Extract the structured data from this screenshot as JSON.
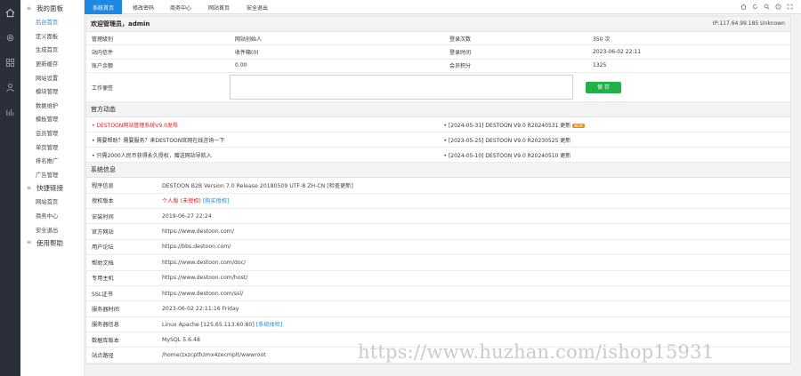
{
  "sidebar": {
    "groups": [
      {
        "title": "我的面板",
        "items": [
          "后台首页",
          "定义面板",
          "生成首页",
          "更新缓存",
          "网站设置",
          "模块管理",
          "数据维护",
          "模板管理",
          "会员管理",
          "单页管理",
          "排名推广",
          "广告管理"
        ]
      },
      {
        "title": "快捷链接",
        "items": [
          "网站首页",
          "商务中心",
          "安全退出"
        ]
      },
      {
        "title": "使用帮助",
        "items": []
      }
    ]
  },
  "topbar": {
    "tabs": [
      "系统首页",
      "修改密码",
      "商务中心",
      "网站首页",
      "安全退出"
    ]
  },
  "welcome": {
    "text": "欢迎管理员，admin",
    "ip": "IP:117.64.99.185 Unknown"
  },
  "account": {
    "rows": [
      {
        "k1": "管理级别",
        "v1": "网站创始人",
        "k2": "登录次数",
        "v2": "350 次"
      },
      {
        "k1": "站内信件",
        "v1": "收件箱(0)",
        "k2": "登录时间",
        "v2": "2023-06-02 22:11"
      },
      {
        "k1": "账户余额",
        "v1": "0.00",
        "k2": "会员积分",
        "v2": "1325"
      }
    ],
    "notes_label": "工作便签",
    "save_label": "保 存"
  },
  "notices": {
    "title": "官方动态",
    "left": [
      "• DESTOON网站管理系统V9.0发布",
      "• 需要帮助？需要服务？来DESTOON官网在线咨询一下",
      "• 只需2000人民币获得永久授权，赠送网站导航入"
    ],
    "right": [
      "• [2024-05-31]  DESTOON V9.0 R20240531 更新",
      "• [2023-05-25]  DESTOON V9.0 R20230525 更新",
      "• [2024-05-10]  DESTOON V9.0 R20240510 更新"
    ]
  },
  "system": {
    "title": "系统信息",
    "rows": [
      {
        "k": "程序信息",
        "v": "DESTOON B2B Version 7.0 Release 20180509 UTF-8 ZH-CN [检查更新]",
        "blue": true
      },
      {
        "k": "授权版本",
        "v": "个人版 (未授权)",
        "link": "[购买授权]",
        "blue": true
      },
      {
        "k": "安装时间",
        "v": "2019-06-27 22:24"
      },
      {
        "k": "官方网站",
        "v": "https://www.destoon.com/"
      },
      {
        "k": "用户论坛",
        "v": "https://bbs.destoon.com/"
      },
      {
        "k": "帮助文档",
        "v": "https://www.destoon.com/doc/"
      },
      {
        "k": "专用主机",
        "v": "https://www.destoon.com/host/"
      },
      {
        "k": "SSL证书",
        "v": "https://www.destoon.com/ssl/"
      },
      {
        "k": "服务器时间",
        "v": "2023-06-02 22:11:16 Friday"
      },
      {
        "k": "服务器信息",
        "v": "Linux Apache [125.65.113.60:80]",
        "link": "[系统体检]"
      },
      {
        "k": "数据库版本",
        "v": "MySQL 5.6.48"
      },
      {
        "k": "站点路径",
        "v": "/home/zxzcpthzmx4zecmplt/wwwroot"
      }
    ]
  },
  "watermark": "https://www.huzhan.com/ishop15931",
  "colors": {
    "accent": "#1e88e5",
    "save": "#21b14a",
    "rail": "#2b2f3a"
  }
}
